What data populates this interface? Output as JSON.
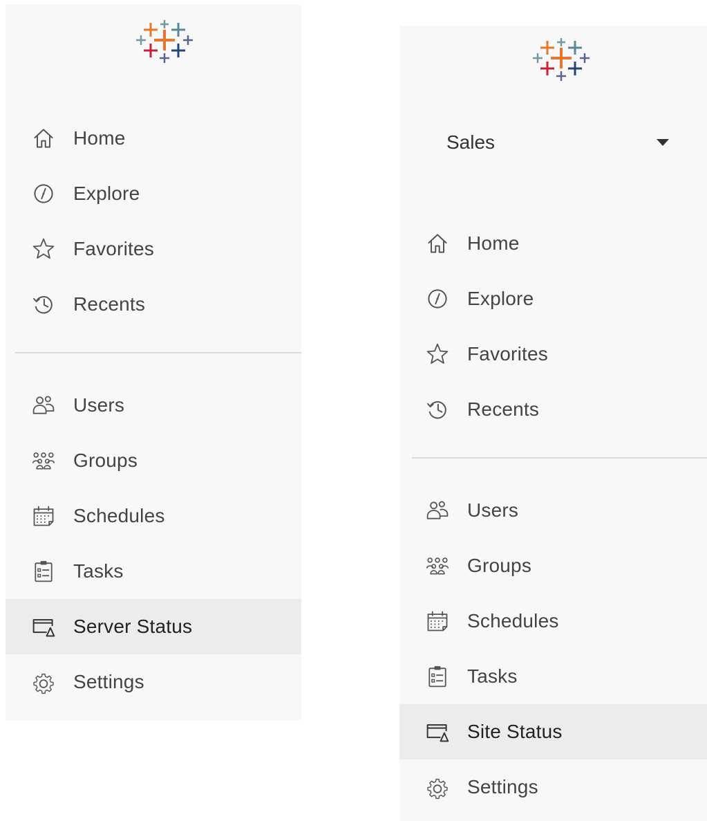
{
  "colors": {
    "panel_bg": "#f8f8f8",
    "active_bg": "#ececec",
    "text": "#444444",
    "icon": "#555555",
    "divider": "#dcdcdc",
    "logo_orange": "#e8762b",
    "logo_blue": "#5b6591",
    "logo_navy": "#1f447e",
    "logo_teal": "#59879b",
    "logo_red": "#c72035",
    "logo_gray": "#7099a6"
  },
  "left_panel": {
    "nav_top": [
      {
        "label": "Home",
        "icon": "home-icon"
      },
      {
        "label": "Explore",
        "icon": "compass-icon"
      },
      {
        "label": "Favorites",
        "icon": "star-icon"
      },
      {
        "label": "Recents",
        "icon": "history-icon"
      }
    ],
    "nav_admin": [
      {
        "label": "Users",
        "icon": "users-icon"
      },
      {
        "label": "Groups",
        "icon": "groups-icon"
      },
      {
        "label": "Schedules",
        "icon": "calendar-icon"
      },
      {
        "label": "Tasks",
        "icon": "clipboard-icon"
      },
      {
        "label": "Server Status",
        "icon": "status-icon",
        "active": true
      },
      {
        "label": "Settings",
        "icon": "gear-icon"
      }
    ]
  },
  "right_panel": {
    "site_selector": {
      "value": "Sales",
      "icon": "caret-down-icon"
    },
    "nav_top": [
      {
        "label": "Home",
        "icon": "home-icon"
      },
      {
        "label": "Explore",
        "icon": "compass-icon"
      },
      {
        "label": "Favorites",
        "icon": "star-icon"
      },
      {
        "label": "Recents",
        "icon": "history-icon"
      }
    ],
    "nav_admin": [
      {
        "label": "Users",
        "icon": "users-icon"
      },
      {
        "label": "Groups",
        "icon": "groups-icon"
      },
      {
        "label": "Schedules",
        "icon": "calendar-icon"
      },
      {
        "label": "Tasks",
        "icon": "clipboard-icon"
      },
      {
        "label": "Site Status",
        "icon": "status-icon",
        "active": true
      },
      {
        "label": "Settings",
        "icon": "gear-icon"
      }
    ]
  }
}
